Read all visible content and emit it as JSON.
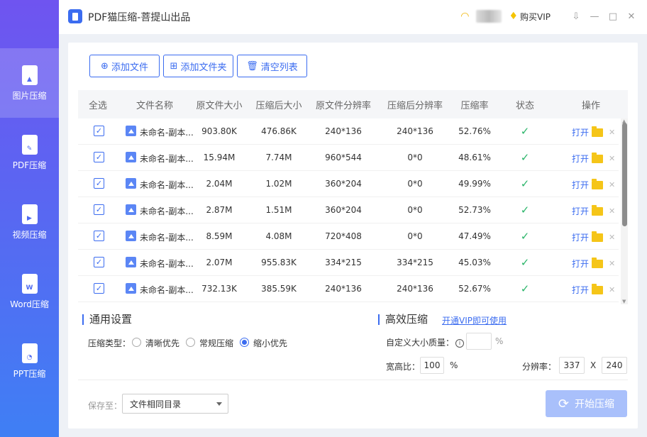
{
  "app": {
    "title": "PDF猫压缩-菩提山出品",
    "buy_vip": "购买VIP"
  },
  "sidebar": {
    "items": [
      {
        "label": "图片压缩",
        "icon": "image-file-icon",
        "glyph": "▲"
      },
      {
        "label": "PDF压缩",
        "icon": "pdf-file-icon",
        "glyph": "✎"
      },
      {
        "label": "视频压缩",
        "icon": "video-file-icon",
        "glyph": "▶"
      },
      {
        "label": "Word压缩",
        "icon": "word-file-icon",
        "glyph": "W"
      },
      {
        "label": "PPT压缩",
        "icon": "ppt-file-icon",
        "glyph": "◔"
      }
    ]
  },
  "toolbar": {
    "add_file": "添加文件",
    "add_folder": "添加文件夹",
    "clear_list": "清空列表"
  },
  "table": {
    "headers": [
      "全选",
      "文件名称",
      "原文件大小",
      "压缩后大小",
      "原文件分辨率",
      "压缩后分辨率",
      "压缩率",
      "状态",
      "操作"
    ],
    "open_label": "打开",
    "rows": [
      {
        "name": "未命名-副本...",
        "orig_size": "903.80K",
        "new_size": "476.86K",
        "orig_res": "240*136",
        "new_res": "240*136",
        "ratio": "52.76%"
      },
      {
        "name": "未命名-副本...",
        "orig_size": "15.94M",
        "new_size": "7.74M",
        "orig_res": "960*544",
        "new_res": "0*0",
        "ratio": "48.61%"
      },
      {
        "name": "未命名-副本...",
        "orig_size": "2.04M",
        "new_size": "1.02M",
        "orig_res": "360*204",
        "new_res": "0*0",
        "ratio": "49.99%"
      },
      {
        "name": "未命名-副本...",
        "orig_size": "2.87M",
        "new_size": "1.51M",
        "orig_res": "360*204",
        "new_res": "0*0",
        "ratio": "52.73%"
      },
      {
        "name": "未命名-副本...",
        "orig_size": "8.59M",
        "new_size": "4.08M",
        "orig_res": "720*408",
        "new_res": "0*0",
        "ratio": "47.49%"
      },
      {
        "name": "未命名-副本...",
        "orig_size": "2.07M",
        "new_size": "955.83K",
        "orig_res": "334*215",
        "new_res": "334*215",
        "ratio": "45.03%"
      },
      {
        "name": "未命名-副本...",
        "orig_size": "732.13K",
        "new_size": "385.59K",
        "orig_res": "240*136",
        "new_res": "240*136",
        "ratio": "52.67%"
      }
    ]
  },
  "general": {
    "title": "通用设置",
    "type_label": "压缩类型：",
    "options": [
      "清晰优先",
      "常规压缩",
      "缩小优先"
    ],
    "selected": "缩小优先"
  },
  "efficient": {
    "title": "高效压缩",
    "vip_link": "开通VIP即可使用",
    "custom_label": "自定义大小质量：",
    "custom_value": "",
    "percent": "%",
    "ratio_label": "宽高比：",
    "ratio_value": "100",
    "res_label": "分辨率：",
    "res_w": "337",
    "res_x": "X",
    "res_h": "240"
  },
  "save": {
    "label": "保存至：",
    "value": "文件相同目录"
  },
  "start_label": "开始压缩",
  "colors": {
    "accent": "#3b6cf0",
    "success": "#2bb56a",
    "folder": "#f5c518",
    "start_disabled": "#a9c0fb"
  }
}
